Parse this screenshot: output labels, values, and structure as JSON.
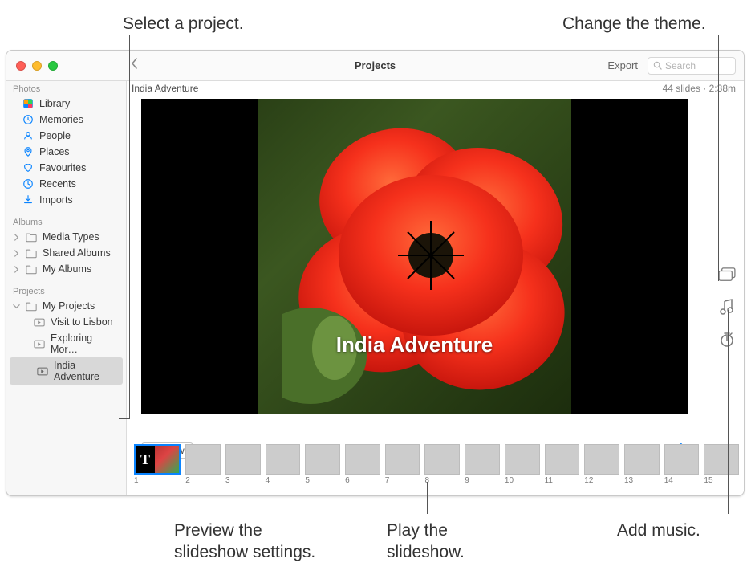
{
  "callouts": {
    "select_project": "Select a project.",
    "change_theme": "Change the theme.",
    "preview_settings": "Preview the\nslideshow settings.",
    "play": "Play the\nslideshow.",
    "add_music": "Add music."
  },
  "titlebar": {
    "title": "Projects",
    "export": "Export",
    "search_placeholder": "Search"
  },
  "sidebar": {
    "sections": {
      "photos": "Photos",
      "albums": "Albums",
      "projects": "Projects"
    },
    "photos_items": [
      {
        "label": "Library"
      },
      {
        "label": "Memories"
      },
      {
        "label": "People"
      },
      {
        "label": "Places"
      },
      {
        "label": "Favourites"
      },
      {
        "label": "Recents"
      },
      {
        "label": "Imports"
      }
    ],
    "albums_items": [
      {
        "label": "Media Types"
      },
      {
        "label": "Shared Albums"
      },
      {
        "label": "My Albums"
      }
    ],
    "projects_group": "My Projects",
    "projects_items": [
      {
        "label": "Visit to Lisbon"
      },
      {
        "label": "Exploring Mor…"
      },
      {
        "label": "India Adventure",
        "selected": true
      }
    ]
  },
  "project": {
    "name": "India Adventure",
    "meta": "44 slides · 2:38m",
    "title_overlay": "India Adventure"
  },
  "footer": {
    "preview": "Preview"
  },
  "thumbnails": [
    {
      "n": "1"
    },
    {
      "n": "2"
    },
    {
      "n": "3"
    },
    {
      "n": "4"
    },
    {
      "n": "5"
    },
    {
      "n": "6"
    },
    {
      "n": "7"
    },
    {
      "n": "8"
    },
    {
      "n": "9"
    },
    {
      "n": "10"
    },
    {
      "n": "11"
    },
    {
      "n": "12"
    },
    {
      "n": "13"
    },
    {
      "n": "14"
    },
    {
      "n": "15"
    }
  ],
  "icons": {
    "T": "T"
  }
}
